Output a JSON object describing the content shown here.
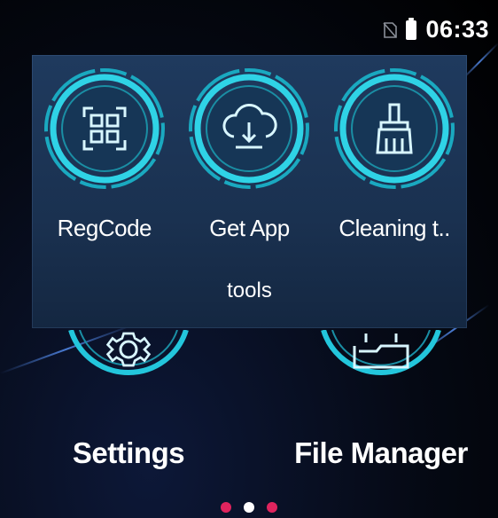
{
  "status_bar": {
    "time": "06:33",
    "icons": [
      "no-sim-icon",
      "battery-icon"
    ]
  },
  "folder": {
    "title": "tools",
    "apps": [
      {
        "label": "RegCode",
        "icon": "qr-code-icon"
      },
      {
        "label": "Get App",
        "icon": "cloud-download-icon"
      },
      {
        "label": "Cleaning t..",
        "icon": "broom-icon"
      }
    ]
  },
  "home_apps": [
    {
      "label": "Settings",
      "icon": "gear-icon"
    },
    {
      "label": "File Manager",
      "icon": "folder-icon"
    }
  ],
  "page_indicator": {
    "count": 3,
    "active_index": 1
  },
  "colors": {
    "accent": "#2fd3e6",
    "folder_bg": "#1f3a5e",
    "dot_inactive": "#e0245e",
    "dot_active": "#ffffff"
  }
}
